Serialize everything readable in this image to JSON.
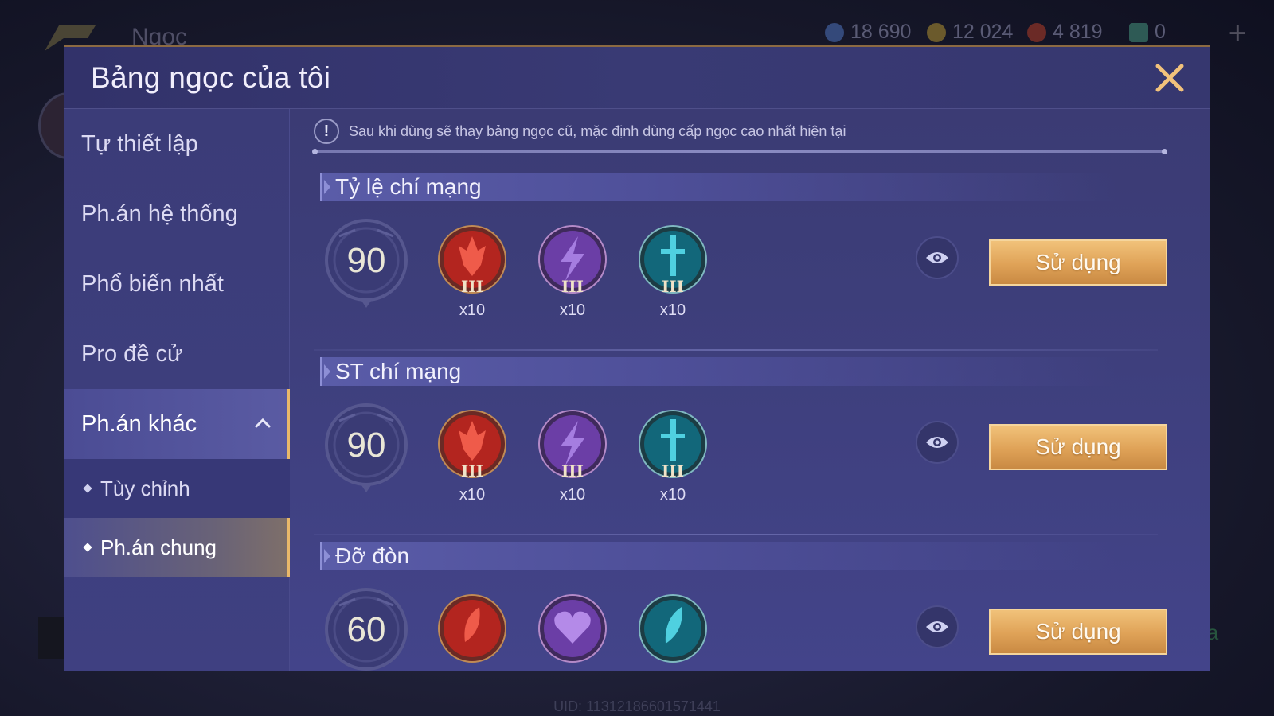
{
  "background": {
    "title": "Ngọc",
    "currencies": [
      {
        "icon": "blue-gem-icon",
        "value": "18 690",
        "color": "#4a6fb5"
      },
      {
        "icon": "gold-coin-icon",
        "value": "12 024",
        "color": "#b08a35"
      },
      {
        "icon": "red-crystal-icon",
        "value": "4 819",
        "color": "#a33a2e"
      },
      {
        "icon": "green-voucher-icon",
        "value": "0",
        "color": "#3f8a7a"
      }
    ],
    "uid": "UID: 11312186601571441",
    "right_label": "la"
  },
  "modal": {
    "title": "Bảng ngọc của tôi",
    "close_icon": "close-icon"
  },
  "sidebar": {
    "items": [
      {
        "label": "Tự thiết lập"
      },
      {
        "label": "Ph.án hệ thống"
      },
      {
        "label": "Phổ biến nhất"
      },
      {
        "label": "Pro đề cử"
      },
      {
        "label": "Ph.án khác",
        "expanded": true
      }
    ],
    "sub_items": [
      {
        "label": "Tùy chỉnh"
      },
      {
        "label": "Ph.án chung",
        "selected": true
      }
    ]
  },
  "notice": {
    "text": "Sau khi dùng sẽ thay bảng ngọc cũ, mặc định dùng cấp ngọc cao nhất hiện tại"
  },
  "sections": [
    {
      "title": "Tỷ lệ chí mạng",
      "level": "90",
      "gems": [
        {
          "icon": "red-crit-gem-icon",
          "tier": "III",
          "count": "x10"
        },
        {
          "icon": "purple-lightning-gem-icon",
          "tier": "III",
          "count": "x10"
        },
        {
          "icon": "teal-sword-gem-icon",
          "tier": "III",
          "count": "x10"
        }
      ],
      "button": "Sử dụng"
    },
    {
      "title": "ST chí mạng",
      "level": "90",
      "gems": [
        {
          "icon": "red-crit-gem-icon",
          "tier": "III",
          "count": "x10"
        },
        {
          "icon": "purple-lightning-gem-icon",
          "tier": "III",
          "count": "x10"
        },
        {
          "icon": "teal-sword-gem-icon",
          "tier": "III",
          "count": "x10"
        }
      ],
      "button": "Sử dụng"
    },
    {
      "title": "Đỡ đòn",
      "level": "60",
      "gems": [
        {
          "icon": "red-leaf-gem-icon",
          "tier": "",
          "count": ""
        },
        {
          "icon": "purple-heart-gem-icon",
          "tier": "",
          "count": ""
        },
        {
          "icon": "teal-leaf-gem-icon",
          "tier": "",
          "count": ""
        }
      ],
      "button": "Sử dụng"
    }
  ],
  "colors": {
    "accent_gold": "#e9b86a",
    "panel": "#3d3e7a",
    "gem_red": "#b3251f",
    "gem_purple": "#6b3ea6",
    "gem_teal": "#12677a"
  }
}
